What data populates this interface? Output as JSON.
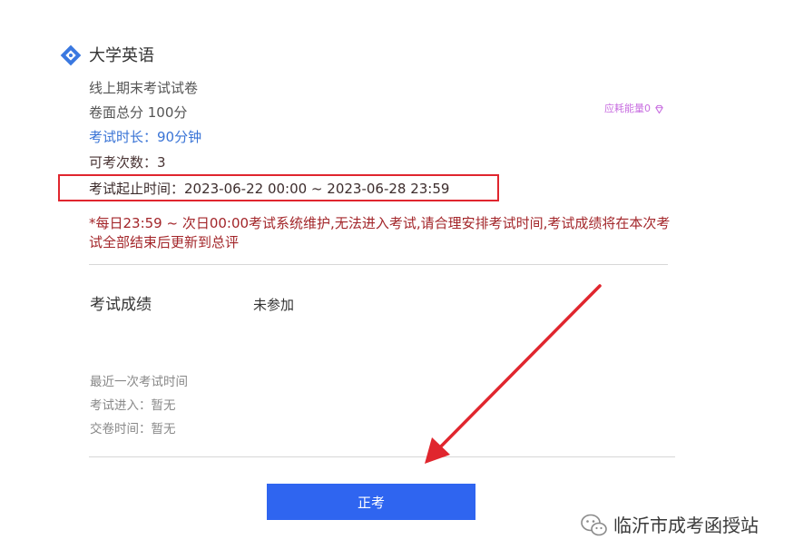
{
  "course": {
    "title": "大学英语",
    "icon": "course-diamond-icon",
    "icon_color": "#3a78e0"
  },
  "exam": {
    "paper_name": "线上期末考试试卷",
    "total_score": "卷面总分 100分",
    "duration": "考试时长：90分钟",
    "attempts": "可考次数：3",
    "time_range": "考试起止时间：2023-06-22 00:00 ~ 2023-06-28 23:59",
    "energy": "应耗能量0",
    "energy_icon": "gem-icon",
    "notice": "*每日23:59 ~ 次日00:00考试系统维护,无法进入考试,请合理安排考试时间,考试成绩将在本次考试全部结束后更新到总评"
  },
  "result": {
    "label": "考试成绩",
    "value": "未参加"
  },
  "recent": {
    "title": "最近一次考试时间",
    "enter": "考试进入：暂无",
    "submit": "交卷时间：暂无"
  },
  "actions": {
    "start_label": "正考"
  },
  "watermark": {
    "text": "临沂市成考函授站",
    "icon": "wechat-icon"
  },
  "colors": {
    "accent": "#2f65f0",
    "annotation_red": "#e0262e",
    "notice_red": "#a3262a",
    "duration_blue": "#3a74d6",
    "energy_purple": "#c86ee0"
  }
}
